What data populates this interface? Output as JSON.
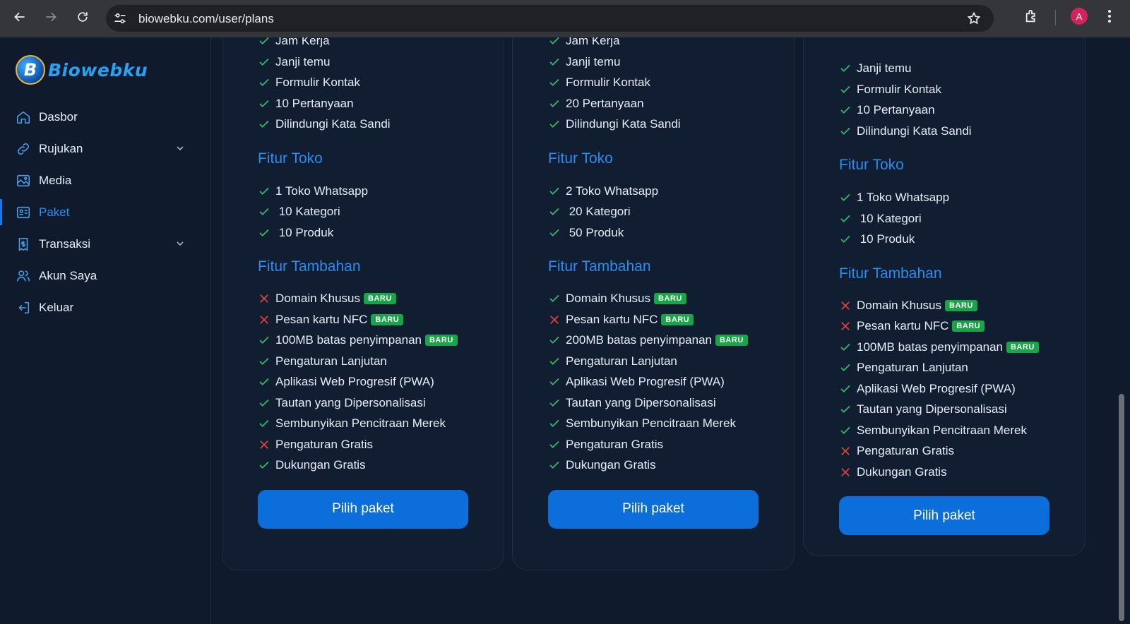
{
  "browser": {
    "url": "biowebku.com/user/plans",
    "profile_initial": "A"
  },
  "sidebar": {
    "logo_mark": "B",
    "logo_text": "Biowebku",
    "items": [
      {
        "label": "Dasbor",
        "icon": "home-icon",
        "has_chevron": false,
        "active": false
      },
      {
        "label": "Rujukan",
        "icon": "link-icon",
        "has_chevron": true,
        "active": false
      },
      {
        "label": "Media",
        "icon": "image-icon",
        "has_chevron": false,
        "active": false
      },
      {
        "label": "Paket",
        "icon": "id-card-icon",
        "has_chevron": false,
        "active": true
      },
      {
        "label": "Transaksi",
        "icon": "receipt-icon",
        "has_chevron": true,
        "active": false
      },
      {
        "label": "Akun Saya",
        "icon": "users-icon",
        "has_chevron": false,
        "active": false
      },
      {
        "label": "Keluar",
        "icon": "logout-icon",
        "has_chevron": false,
        "active": false
      }
    ]
  },
  "plans": [
    {
      "general": [
        {
          "text": "Jam Kerja",
          "ok": true
        },
        {
          "text": "Janji temu",
          "ok": true
        },
        {
          "text": "Formulir Kontak",
          "ok": true
        },
        {
          "text": "10 Pertanyaan",
          "ok": true
        },
        {
          "text": "Dilindungi Kata Sandi",
          "ok": true
        }
      ],
      "store_title": "Fitur Toko",
      "store": [
        {
          "text": "1 Toko Whatsapp",
          "ok": true
        },
        {
          "text": " 10 Kategori",
          "ok": true
        },
        {
          "text": " 10 Produk",
          "ok": true
        }
      ],
      "extra_title": "Fitur Tambahan",
      "extra": [
        {
          "text": "Domain Khusus",
          "ok": false,
          "badge": "BARU"
        },
        {
          "text": "Pesan kartu NFC",
          "ok": false,
          "badge": "BARU"
        },
        {
          "text": "100MB batas penyimpanan",
          "ok": true,
          "badge": "BARU"
        },
        {
          "text": "Pengaturan Lanjutan",
          "ok": true
        },
        {
          "text": "Aplikasi Web Progresif (PWA)",
          "ok": true
        },
        {
          "text": "Tautan yang Dipersonalisasi",
          "ok": true
        },
        {
          "text": "Sembunyikan Pencitraan Merek",
          "ok": true
        },
        {
          "text": "Pengaturan Gratis",
          "ok": false
        },
        {
          "text": "Dukungan Gratis",
          "ok": true
        }
      ],
      "button": "Pilih paket"
    },
    {
      "general": [
        {
          "text": "Jam Kerja",
          "ok": true
        },
        {
          "text": "Janji temu",
          "ok": true
        },
        {
          "text": "Formulir Kontak",
          "ok": true
        },
        {
          "text": "20 Pertanyaan",
          "ok": true
        },
        {
          "text": "Dilindungi Kata Sandi",
          "ok": true
        }
      ],
      "store_title": "Fitur Toko",
      "store": [
        {
          "text": "2 Toko Whatsapp",
          "ok": true
        },
        {
          "text": " 20 Kategori",
          "ok": true
        },
        {
          "text": " 50 Produk",
          "ok": true
        }
      ],
      "extra_title": "Fitur Tambahan",
      "extra": [
        {
          "text": "Domain Khusus",
          "ok": true,
          "badge": "BARU"
        },
        {
          "text": "Pesan kartu NFC",
          "ok": false,
          "badge": "BARU"
        },
        {
          "text": "200MB batas penyimpanan",
          "ok": true,
          "badge": "BARU"
        },
        {
          "text": "Pengaturan Lanjutan",
          "ok": true
        },
        {
          "text": "Aplikasi Web Progresif (PWA)",
          "ok": true
        },
        {
          "text": "Tautan yang Dipersonalisasi",
          "ok": true
        },
        {
          "text": "Sembunyikan Pencitraan Merek",
          "ok": true
        },
        {
          "text": "Pengaturan Gratis",
          "ok": true
        },
        {
          "text": "Dukungan Gratis",
          "ok": true
        }
      ],
      "button": "Pilih paket"
    },
    {
      "general": [
        {
          "text": "Janji temu",
          "ok": true
        },
        {
          "text": "Formulir Kontak",
          "ok": true
        },
        {
          "text": "10 Pertanyaan",
          "ok": true
        },
        {
          "text": "Dilindungi Kata Sandi",
          "ok": true
        }
      ],
      "store_title": "Fitur Toko",
      "store": [
        {
          "text": "1 Toko Whatsapp",
          "ok": true
        },
        {
          "text": " 10 Kategori",
          "ok": true
        },
        {
          "text": " 10 Produk",
          "ok": true
        }
      ],
      "extra_title": "Fitur Tambahan",
      "extra": [
        {
          "text": "Domain Khusus",
          "ok": false,
          "badge": "BARU"
        },
        {
          "text": "Pesan kartu NFC",
          "ok": false,
          "badge": "BARU"
        },
        {
          "text": "100MB batas penyimpanan",
          "ok": true,
          "badge": "BARU"
        },
        {
          "text": "Pengaturan Lanjutan",
          "ok": true
        },
        {
          "text": "Aplikasi Web Progresif (PWA)",
          "ok": true
        },
        {
          "text": "Tautan yang Dipersonalisasi",
          "ok": true
        },
        {
          "text": "Sembunyikan Pencitraan Merek",
          "ok": true
        },
        {
          "text": "Pengaturan Gratis",
          "ok": false
        },
        {
          "text": "Dukungan Gratis",
          "ok": false
        }
      ],
      "button": "Pilih paket"
    }
  ],
  "colors": {
    "accent": "#2a8cf0",
    "button": "#0c6edb",
    "check": "#2fc26a",
    "cross": "#e0453c",
    "badge": "#18a548"
  }
}
